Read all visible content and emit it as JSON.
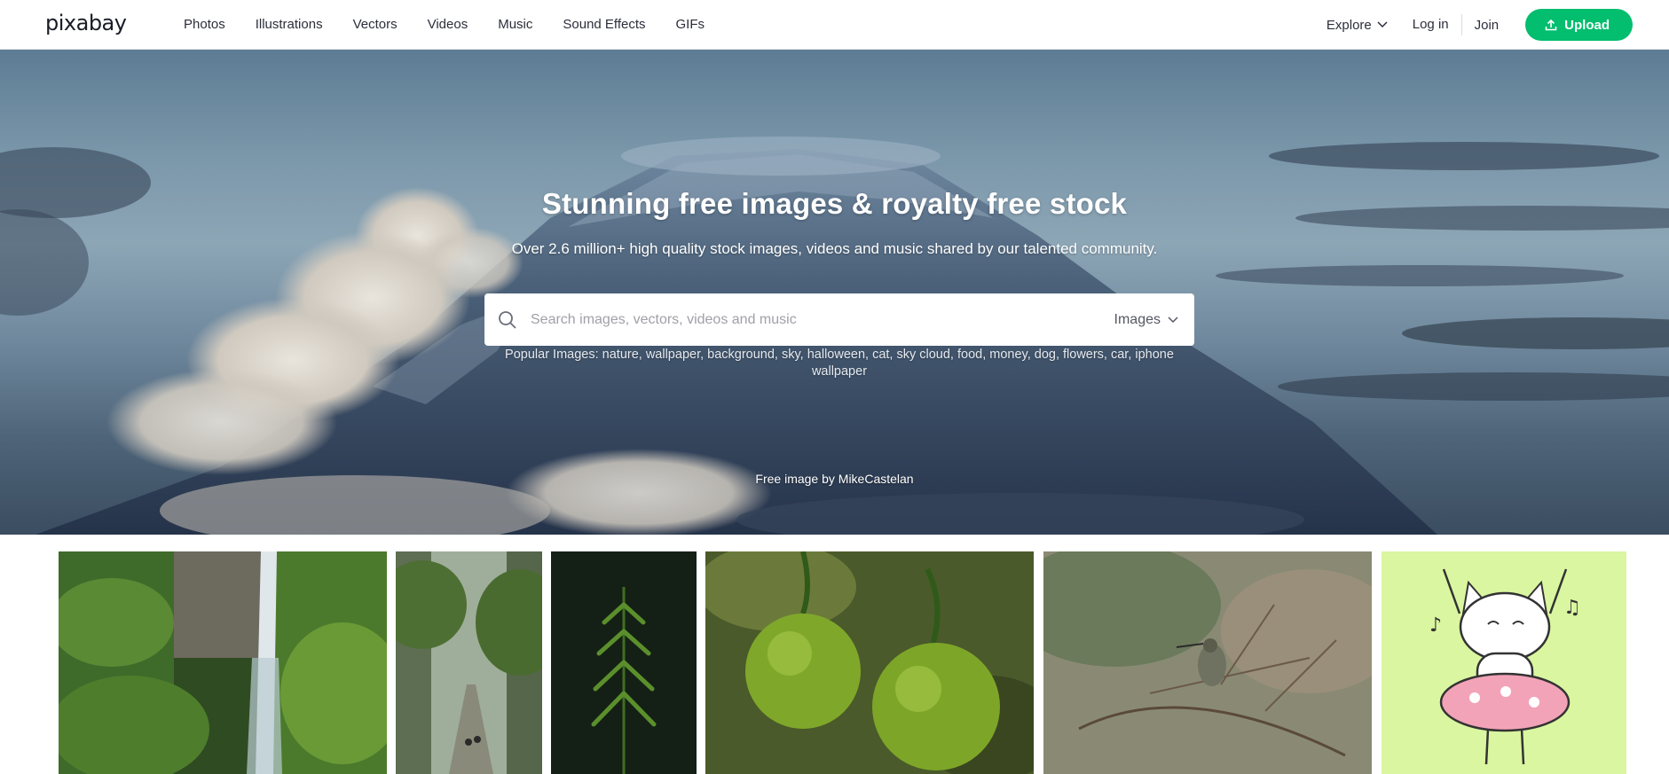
{
  "header": {
    "logo": "pixabay",
    "nav": [
      "Photos",
      "Illustrations",
      "Vectors",
      "Videos",
      "Music",
      "Sound Effects",
      "GIFs"
    ],
    "explore": "Explore",
    "login": "Log in",
    "join": "Join",
    "upload": "Upload"
  },
  "hero": {
    "title": "Stunning free images & royalty free stock",
    "subtitle": "Over 2.6 million+ high quality stock images, videos and music shared by our talented community.",
    "search_placeholder": "Search images, vectors, videos and music",
    "search_type": "Images",
    "popular": "Popular Images: nature, wallpaper, background, sky, halloween, cat, sky cloud, food, money, dog, flowers, car, iphone wallpaper",
    "credit": "Free image by MikeCastelan"
  },
  "colors": {
    "brand_green": "#02be6e"
  },
  "icons": {
    "search": "search-icon",
    "chevron": "chevron-down-icon",
    "upload": "upload-icon"
  }
}
